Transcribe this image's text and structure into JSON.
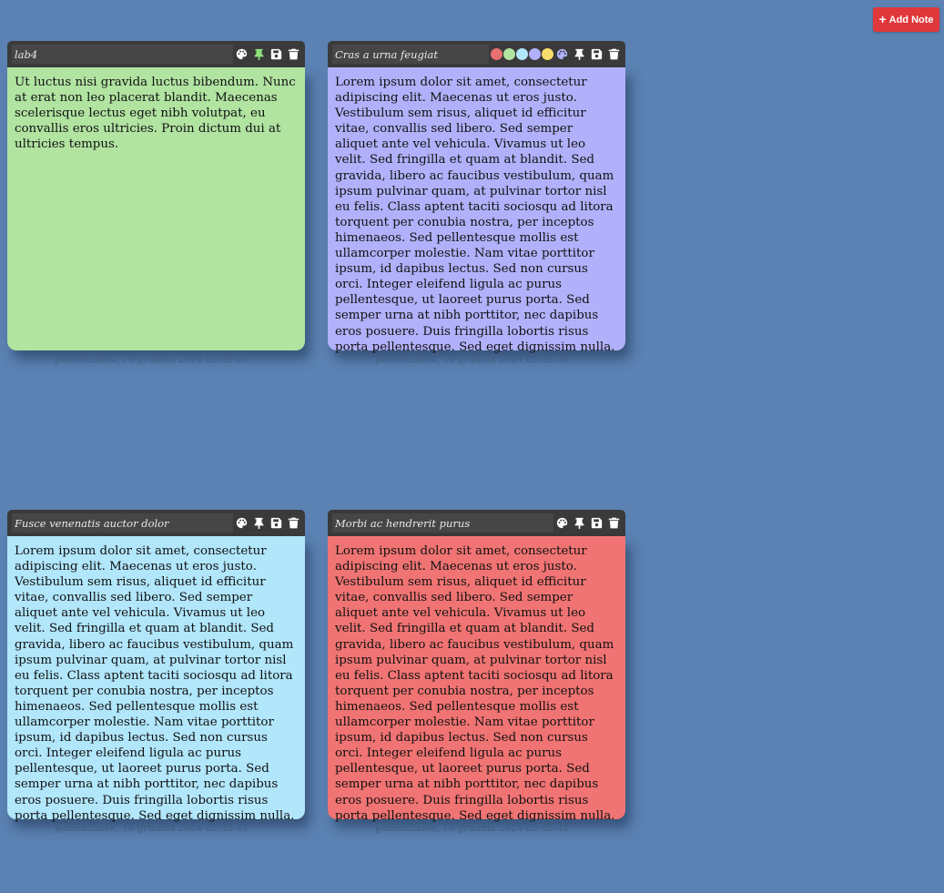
{
  "header": {
    "add_note_label": "Add Note"
  },
  "colors": {
    "background": "#5b82b3",
    "note_header": "#3a3a3a",
    "add_button": "#e0373a",
    "swatches": [
      "#e77070",
      "#b1e3a1",
      "#b1e6fb",
      "#b1b1fb",
      "#f8dd6c"
    ]
  },
  "notes": [
    {
      "title": "lab4",
      "body": "Ut luctus nisi gravida luctus bibendum. Nunc at erat non leo placerat blandit. Maecenas scelerisque lectus eget nibh volutpat, eu convallis eros ultricies. Proin dictum dui at ultricies tempus.",
      "date": "poniedziałek, 16 grudnia 2024 02:02:10",
      "color": "#b1e3a1",
      "pinned": true,
      "palette_open": false
    },
    {
      "title": "Cras a urna feugiat",
      "body": "Lorem ipsum dolor sit amet, consectetur adipiscing elit. Maecenas ut eros justo. Vestibulum sem risus, aliquet id efficitur vitae, convallis sed libero. Sed semper aliquet ante vel vehicula. Vivamus ut leo velit. Sed fringilla et quam at blandit. Sed gravida, libero ac faucibus vestibulum, quam ipsum pulvinar quam, at pulvinar tortor nisl eu felis. Class aptent taciti sociosqu ad litora torquent per conubia nostra, per inceptos himenaeos. Sed pellentesque mollis est ullamcorper molestie. Nam vitae porttitor ipsum, id dapibus lectus. Sed non cursus orci. Integer eleifend ligula ac purus pellentesque, ut laoreet purus porta. Sed semper urna at nibh porttitor, nec dapibus eros posuere. Duis fringilla lobortis risus porta pellentesque. Sed eget dignissim nulla.",
      "date": "poniedziałek, 16 grudnia 2024 02:02:39",
      "color": "#b1b1fb",
      "pinned": false,
      "palette_open": true
    },
    {
      "title": "Fusce venenatis auctor dolor",
      "body": "Lorem ipsum dolor sit amet, consectetur adipiscing elit. Maecenas ut eros justo. Vestibulum sem risus, aliquet id efficitur vitae, convallis sed libero. Sed semper aliquet ante vel vehicula. Vivamus ut leo velit. Sed fringilla et quam at blandit. Sed gravida, libero ac faucibus vestibulum, quam ipsum pulvinar quam, at pulvinar tortor nisl eu felis. Class aptent taciti sociosqu ad litora torquent per conubia nostra, per inceptos himenaeos. Sed pellentesque mollis est ullamcorper molestie. Nam vitae porttitor ipsum, id dapibus lectus. Sed non cursus orci. Integer eleifend ligula ac purus pellentesque, ut laoreet purus porta. Sed semper urna at nibh porttitor, nec dapibus eros posuere. Duis fringilla lobortis risus porta pellentesque. Sed eget dignissim nulla.",
      "date": "poniedziałek, 16 grudnia 2024 02:02:41",
      "color": "#b1e6fb",
      "pinned": false,
      "palette_open": false
    },
    {
      "title": "Morbi ac hendrerit purus",
      "body": "Lorem ipsum dolor sit amet, consectetur adipiscing elit. Maecenas ut eros justo. Vestibulum sem risus, aliquet id efficitur vitae, convallis sed libero. Sed semper aliquet ante vel vehicula. Vivamus ut leo velit. Sed fringilla et quam at blandit. Sed gravida, libero ac faucibus vestibulum, quam ipsum pulvinar quam, at pulvinar tortor nisl eu felis. Class aptent taciti sociosqu ad litora torquent per conubia nostra, per inceptos himenaeos. Sed pellentesque mollis est ullamcorper molestie. Nam vitae porttitor ipsum, id dapibus lectus. Sed non cursus orci. Integer eleifend ligula ac purus pellentesque, ut laoreet purus porta. Sed semper urna at nibh porttitor, nec dapibus eros posuere. Duis fringilla lobortis risus porta pellentesque. Sed eget dignissim nulla.",
      "date": "poniedziałek, 16 grudnia 2024 02:02:41",
      "color": "#f07473",
      "pinned": false,
      "palette_open": false
    }
  ]
}
